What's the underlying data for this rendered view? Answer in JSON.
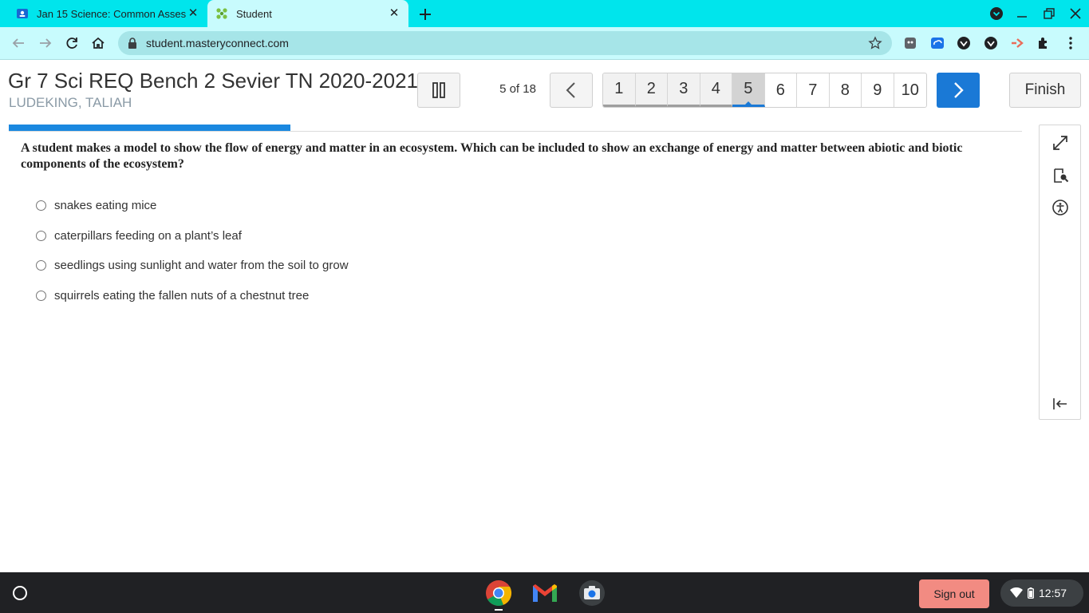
{
  "browser": {
    "tabs": [
      {
        "title": "Jan 15 Science: Common Asses",
        "active": false
      },
      {
        "title": "Student",
        "active": true
      }
    ],
    "url": "student.masteryconnect.com"
  },
  "assessment": {
    "title": "Gr 7 Sci REQ Bench 2 Sevier TN 2020-2021",
    "student": "LUDEKING, TALIAH",
    "counter": "5 of 18",
    "progress": 0.278,
    "pages": [
      "1",
      "2",
      "3",
      "4",
      "5",
      "6",
      "7",
      "8",
      "9",
      "10"
    ],
    "current_page": "5",
    "finish_label": "Finish"
  },
  "question": {
    "text": "A student makes a model to show the flow of energy and matter in an ecosystem. Which can be included to show an exchange of energy and matter between abiotic and biotic components of the ecosystem?",
    "choices": [
      "snakes eating mice",
      "caterpillars feeding on a plant’s leaf",
      "seedlings using sunlight and water from the soil to grow",
      "squirrels eating the fallen nuts of a chestnut tree"
    ]
  },
  "shelf": {
    "signout_label": "Sign out",
    "time": "12:57"
  },
  "colors": {
    "tabstrip": "#00e5ec",
    "accent": "#1a79d6",
    "progress": "#1a88e0",
    "signout": "#f28b82"
  }
}
